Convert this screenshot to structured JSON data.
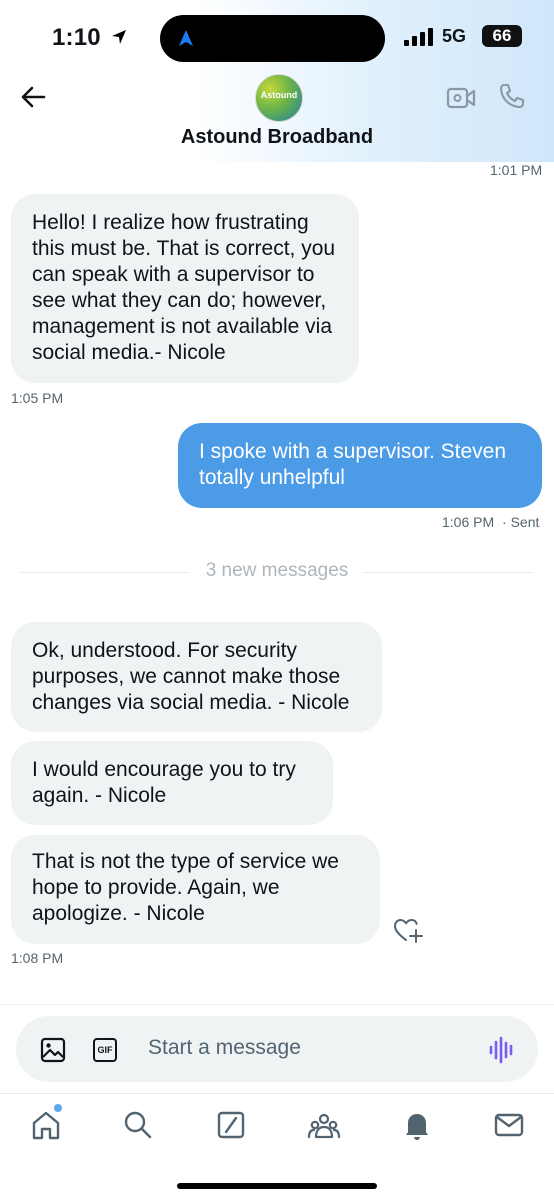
{
  "status_bar": {
    "time": "1:10",
    "network": "5G",
    "battery": "66"
  },
  "header": {
    "title": "Astound Broadband",
    "avatar_text": "Astound"
  },
  "messages": [
    {
      "stamp_above": "1:01 PM"
    },
    {
      "text": "Hello! I realize how frustrating this must be. That is correct, you can speak with a supervisor to see what they can do; however, management is not available via social media.- Nicole",
      "time": "1:05 PM"
    },
    {
      "text": "I spoke with a supervisor. Steven totally unhelpful",
      "time": "1:06 PM",
      "status": "· Sent"
    },
    {
      "divider": "3 new messages"
    },
    {
      "text": "Ok, understood. For security purposes, we cannot make those changes via social media. - Nicole"
    },
    {
      "text": "I would encourage you to try again. - Nicole"
    },
    {
      "text": "That is not the type of service we hope to provide. Again, we apologize. - Nicole",
      "time": "1:08 PM"
    }
  ],
  "compose": {
    "placeholder": "Start a message",
    "gif_label": "GIF"
  },
  "nav": [
    "home-icon",
    "search-icon",
    "grok-icon",
    "communities-icon",
    "notifications-icon",
    "messages-icon"
  ],
  "colors": {
    "sent_bubble": "#4c9be6",
    "received_bubble": "#eff3f4",
    "voice_accent": "#7a5cf0",
    "unread_dot": "#5ca8ea"
  }
}
